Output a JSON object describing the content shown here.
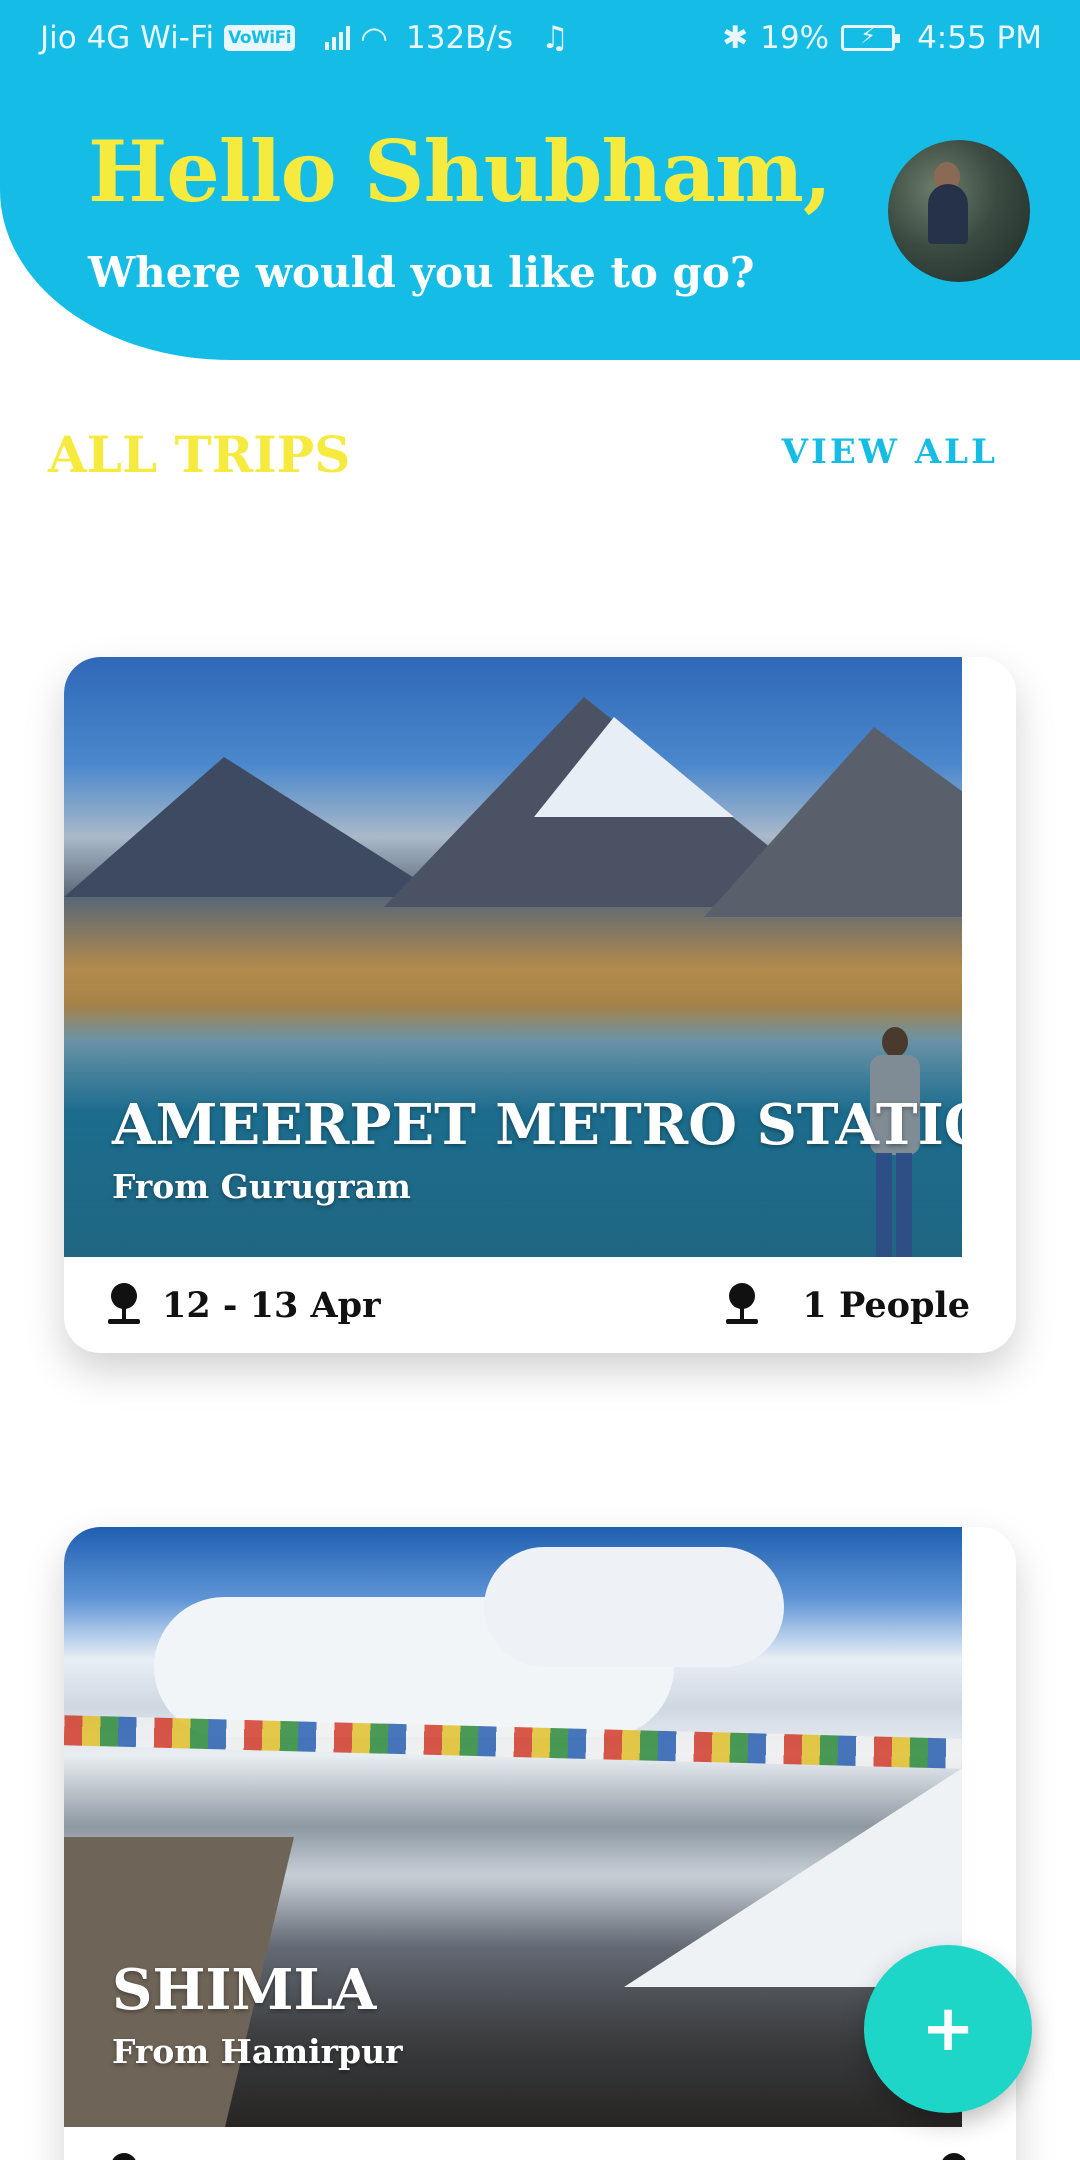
{
  "status_bar": {
    "carrier": "Jio 4G Wi-Fi",
    "vowifi": "VoWiFi",
    "speed": "132B/s",
    "music_icon": "music-note-icon",
    "bluetooth_icon": "bluetooth-icon",
    "battery_percent": "19%",
    "time": "4:55 PM"
  },
  "header": {
    "greeting": "Hello Shubham,",
    "subtitle": "Where would you like to go?",
    "avatar_icon": "user-avatar"
  },
  "section": {
    "title": "ALL TRIPS",
    "view_all": "VIEW ALL"
  },
  "trips": [
    {
      "title": "AMEERPET METRO STATION",
      "from": "From Gurugram",
      "dates": "12 - 13 Apr",
      "people": "1 People"
    },
    {
      "title": "SHIMLA",
      "from": "From Hamirpur"
    }
  ],
  "fab": {
    "label": "+"
  },
  "colors": {
    "primary_blue": "#15bde6",
    "accent_yellow": "#f7ea3f",
    "fab_teal": "#1ed6c7"
  }
}
